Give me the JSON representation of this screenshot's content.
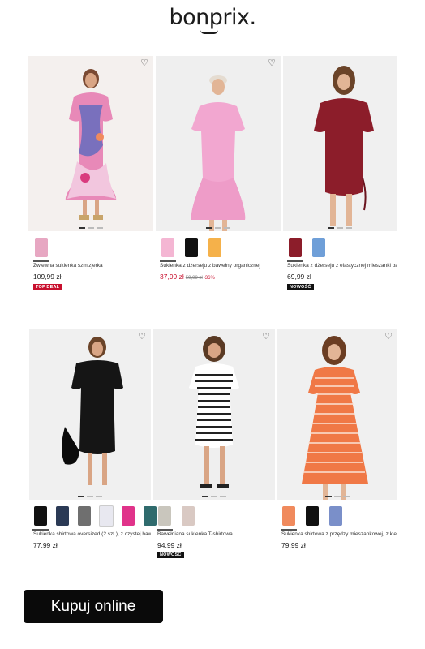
{
  "logo": "bonprix.",
  "cta": "Kupuj online",
  "products": [
    {
      "name": "Zwiewna sukienka szmizjerka",
      "price": "109,99 zł",
      "badge": "TOP DEAL",
      "badge_color": "#c8102e",
      "swatches": [
        "#e7a7c2"
      ]
    },
    {
      "name": "Sukienka z dżerseju z bawełny organicznej",
      "price": "37,99 zł",
      "old_price": "59,99 zł",
      "discount": "-36%",
      "swatches": [
        "#f4b6d3",
        "#111111",
        "#f5b14a"
      ]
    },
    {
      "name": "Sukienka z dżerseju z elastycznej mieszanki bawe",
      "price": "69,99 zł",
      "badge": "NOWOŚĆ",
      "badge_color": "#111111",
      "swatches": [
        "#8c1d2a",
        "#6f9fd8"
      ]
    },
    {
      "name": "Sukienka shirtowa oversized (2 szt.), z czystej baw...",
      "price": "77,99 zł",
      "swatches": [
        "#111111",
        "#2b3a55",
        "#6f6f6f",
        "#e8e8f0",
        "#e0338a",
        "#2f6b6d"
      ]
    },
    {
      "name": "Bawełniana sukienka T-shirtowa",
      "price": "94,99 zł",
      "badge": "NOWOŚĆ",
      "badge_color": "#111111",
      "swatches": [
        "#c9c6bd",
        "#d9c9c3"
      ]
    },
    {
      "name": "Sukienka shirtowa z przędzy mieszankowej, z kies...",
      "price": "79,99 zł",
      "swatches": [
        "#f08a5d",
        "#111111",
        "#7a8fc9"
      ]
    }
  ]
}
